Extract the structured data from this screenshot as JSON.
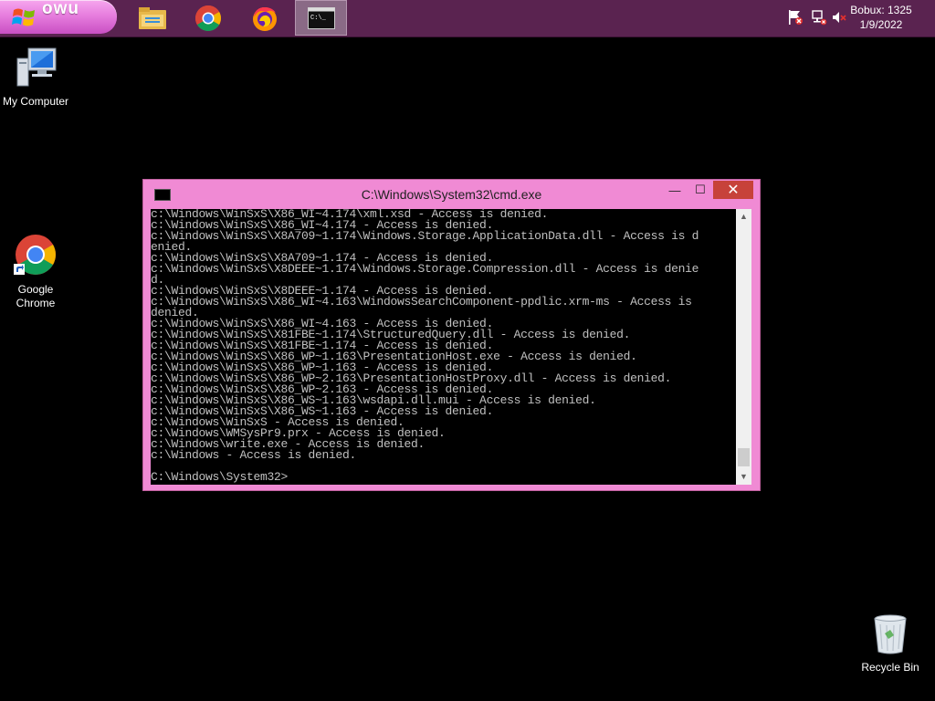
{
  "taskbar": {
    "start_label": "owu",
    "apps": [
      {
        "name": "File Explorer",
        "icon": "folder-icon"
      },
      {
        "name": "Google Chrome",
        "icon": "chrome-icon"
      },
      {
        "name": "Firefox",
        "icon": "firefox-icon"
      },
      {
        "name": "Command Prompt",
        "icon": "cmd-icon",
        "active": true
      }
    ],
    "tray": {
      "icons": [
        "flag-icon",
        "network-icon",
        "volume-muted-icon"
      ],
      "clock_line1": "Bobux: 1325",
      "clock_line2": "1/9/2022"
    }
  },
  "desktop": {
    "icons": [
      {
        "label": "My Computer",
        "icon": "computer-icon"
      },
      {
        "label": "Google Chrome",
        "icon": "chrome-icon"
      },
      {
        "label": "Recycle Bin",
        "icon": "recycle-bin-icon"
      }
    ]
  },
  "cmd_window": {
    "title": "C:\\Windows\\System32\\cmd.exe",
    "controls": {
      "minimize": "—",
      "maximize": "☐",
      "close": "✕"
    },
    "lines": [
      "c:\\Windows\\WinSxS\\X86_WI~4.174\\xml.xsd - Access is denied.",
      "c:\\Windows\\WinSxS\\X86_WI~4.174 - Access is denied.",
      "c:\\Windows\\WinSxS\\X8A709~1.174\\Windows.Storage.ApplicationData.dll - Access is d",
      "enied.",
      "c:\\Windows\\WinSxS\\X8A709~1.174 - Access is denied.",
      "c:\\Windows\\WinSxS\\X8DEEE~1.174\\Windows.Storage.Compression.dll - Access is denie",
      "d.",
      "c:\\Windows\\WinSxS\\X8DEEE~1.174 - Access is denied.",
      "c:\\Windows\\WinSxS\\X86_WI~4.163\\WindowsSearchComponent-ppdlic.xrm-ms - Access is",
      "denied.",
      "c:\\Windows\\WinSxS\\X86_WI~4.163 - Access is denied.",
      "c:\\Windows\\WinSxS\\X81FBE~1.174\\StructuredQuery.dll - Access is denied.",
      "c:\\Windows\\WinSxS\\X81FBE~1.174 - Access is denied.",
      "c:\\Windows\\WinSxS\\X86_WP~1.163\\PresentationHost.exe - Access is denied.",
      "c:\\Windows\\WinSxS\\X86_WP~1.163 - Access is denied.",
      "c:\\Windows\\WinSxS\\X86_WP~2.163\\PresentationHostProxy.dll - Access is denied.",
      "c:\\Windows\\WinSxS\\X86_WP~2.163 - Access is denied.",
      "c:\\Windows\\WinSxS\\X86_WS~1.163\\wsdapi.dll.mui - Access is denied.",
      "c:\\Windows\\WinSxS\\X86_WS~1.163 - Access is denied.",
      "c:\\Windows\\WinSxS - Access is denied.",
      "c:\\Windows\\WMSysPr9.prx - Access is denied.",
      "c:\\Windows\\write.exe - Access is denied.",
      "c:\\Windows - Access is denied.",
      "",
      "C:\\Windows\\System32>"
    ]
  },
  "colors": {
    "taskbar_bg": "#5a2350",
    "start_button": "#e77ede",
    "window_frame": "#f08ad4",
    "close_button": "#c7423a",
    "console_text": "#c0c0c0"
  }
}
